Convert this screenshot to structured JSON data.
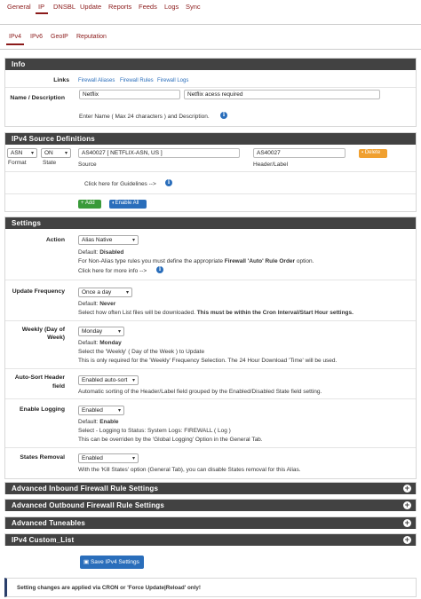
{
  "top_tabs": [
    {
      "label": "General",
      "active": false
    },
    {
      "label": "IP",
      "active": true
    },
    {
      "label": "DNSBL",
      "active": false
    },
    {
      "label": "Update",
      "active": false
    },
    {
      "label": "Reports",
      "active": false
    },
    {
      "label": "Feeds",
      "active": false
    },
    {
      "label": "Logs",
      "active": false
    },
    {
      "label": "Sync",
      "active": false
    }
  ],
  "sub_tabs": [
    {
      "label": "IPv4",
      "active": true
    },
    {
      "label": "IPv6",
      "active": false
    },
    {
      "label": "GeoIP",
      "active": false
    },
    {
      "label": "Reputation",
      "active": false
    }
  ],
  "info": {
    "title": "Info",
    "links_label": "Links",
    "links": [
      "Firewall Aliases",
      "Firewall Rules",
      "Firewall Logs"
    ],
    "name_label": "Name / Description",
    "name_value": "Netflix",
    "description_value": "Netflix acess required",
    "name_hint": "Enter Name ( Max 24 characters ) and Description."
  },
  "source": {
    "title": "IPv4 Source Definitions",
    "format_value": "ASN",
    "state_value": "ON",
    "source_value": "AS40027 [ NETFLIX-ASN, US ]",
    "header_value": "AS40027",
    "delete_label": "Delete",
    "format_label": "Format",
    "state_label": "State",
    "source_label": "Source",
    "header_label": "Header/Label",
    "guidelines": "Click here for Guidelines -->",
    "add_label": "Add",
    "enable_all_label": "Enable All"
  },
  "settings": {
    "title": "Settings",
    "action": {
      "label": "Action",
      "value": "Alias Native",
      "default_prefix": "Default:",
      "default_value": "Disabled",
      "line1_pre": "For Non-Alias type rules you must define the appropriate",
      "line1_bold": "Firewall 'Auto' Rule Order",
      "line1_post": "option.",
      "line2": "Click here for more info -->"
    },
    "update_frequency": {
      "label": "Update Frequency",
      "value": "Once a day",
      "default_prefix": "Default:",
      "default_value": "Never",
      "line_pre": "Select how often List files will be downloaded.",
      "line_bold": "This must be within the Cron Interval/Start Hour settings."
    },
    "weekly": {
      "label_1": "Weekly (Day of",
      "label_2": "Week)",
      "value": "Monday",
      "default_prefix": "Default:",
      "default_value": "Monday",
      "line1": "Select the 'Weekly' ( Day of the Week ) to Update",
      "line2": "This is only required for the 'Weekly' Frequency Selection. The 24 Hour Download 'Time' will be used."
    },
    "auto_sort": {
      "label_1": "Auto-Sort Header",
      "label_2": "field",
      "value": "Enabled auto-sort",
      "line": "Automatic sorting of the Header/Label field grouped by the Enabled/Disabled State field setting."
    },
    "logging": {
      "label": "Enable Logging",
      "value": "Enabled",
      "default_prefix": "Default:",
      "default_value": "Enable",
      "line1": "Select - Logging to Status: System Logs: FIREWALL ( Log )",
      "line2": "This can be overriden by the 'Global Logging' Option in the General Tab."
    },
    "states_removal": {
      "label": "States Removal",
      "value": "Enabled",
      "line": "With the 'Kill States' option (General Tab), you can disable States removal for this Alias."
    }
  },
  "collapsed_panels": [
    "Advanced Inbound Firewall Rule Settings",
    "Advanced Outbound Firewall Rule Settings",
    "Advanced Tuneables",
    "IPv4 Custom_List"
  ],
  "save_label": "Save IPv4 Settings",
  "footer_note": "Setting changes are applied via CRON or 'Force Update|Reload' only!",
  "colors": {
    "accent": "#8b1a1a",
    "panel_header": "#424242",
    "primary": "#2a6ebb",
    "success": "#3a9a3a",
    "warning": "#f0a030"
  }
}
